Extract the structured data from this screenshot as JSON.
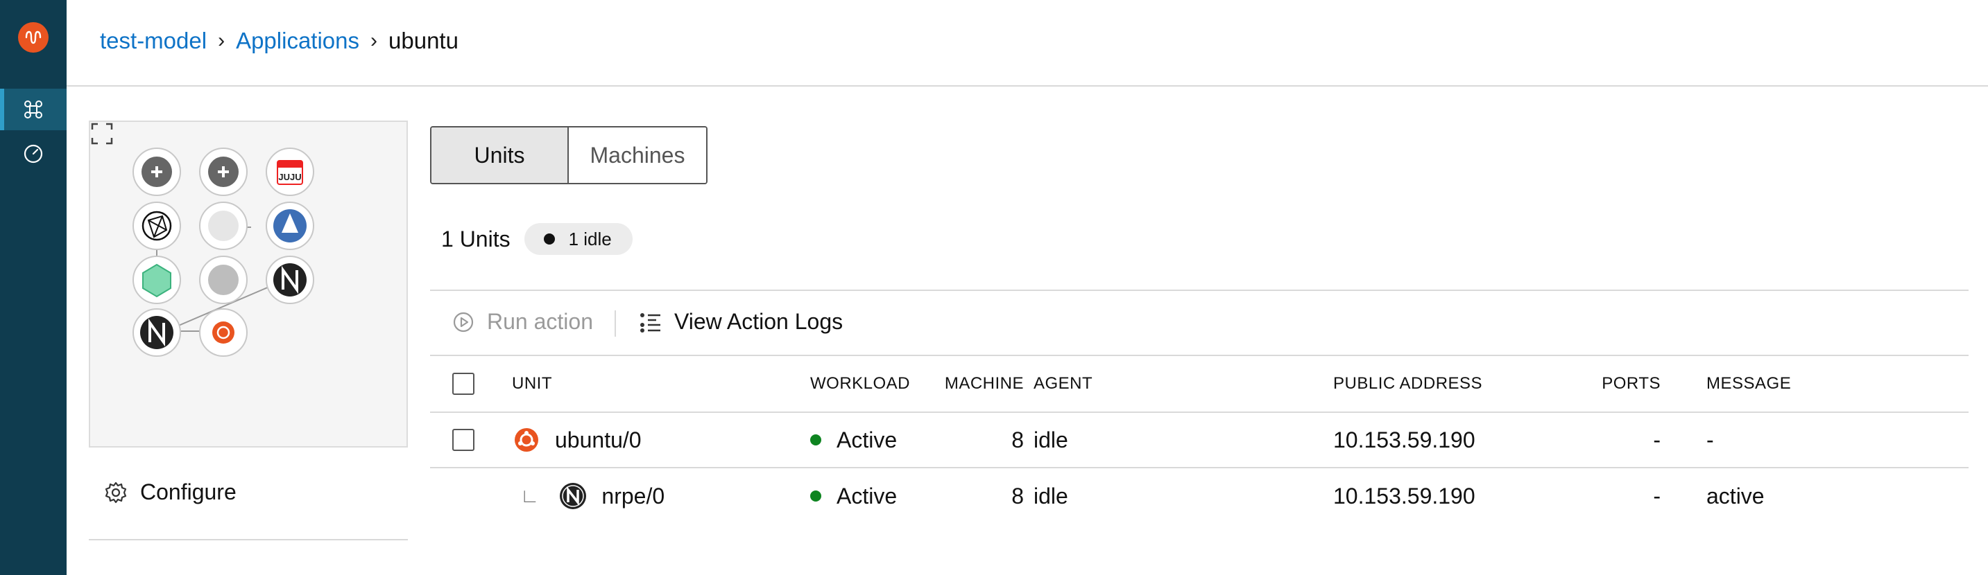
{
  "breadcrumb": {
    "model": "test-model",
    "separator": "›",
    "section": "Applications",
    "current": "ubuntu"
  },
  "sidebar": {
    "items": [
      {
        "name": "applications",
        "icon": "applications-icon",
        "active": true
      },
      {
        "name": "logs",
        "icon": "gauge-icon",
        "active": false
      }
    ]
  },
  "configure_label": "Configure",
  "tabs": [
    {
      "label": "Units",
      "selected": true
    },
    {
      "label": "Machines",
      "selected": false
    }
  ],
  "summary": {
    "count_label": "1 Units",
    "badge_label": "1 idle"
  },
  "actions": {
    "run_action": "Run action",
    "view_logs": "View Action Logs"
  },
  "table": {
    "columns": [
      "UNIT",
      "WORKLOAD",
      "AGENT",
      "MACHINE",
      "PUBLIC ADDRESS",
      "PORTS",
      "MESSAGE"
    ],
    "rows": [
      {
        "unit": "ubuntu/0",
        "icon": "ubuntu-icon",
        "workload": "Active",
        "agent": "idle",
        "machine": "8",
        "address": "10.153.59.190",
        "ports": "-",
        "message": "-",
        "subordinate": false
      },
      {
        "unit": "nrpe/0",
        "icon": "nrpe-icon",
        "workload": "Active",
        "agent": "idle",
        "machine": "8",
        "address": "10.153.59.190",
        "ports": "-",
        "message": "active",
        "subordinate": true,
        "sub_marker": "∟"
      }
    ]
  },
  "colors": {
    "sidebar": "#0f3c4f",
    "link": "#0e73c7",
    "active_status": "#0e8420",
    "ubuntu_orange": "#e95420"
  },
  "topology_label": "JUJU"
}
